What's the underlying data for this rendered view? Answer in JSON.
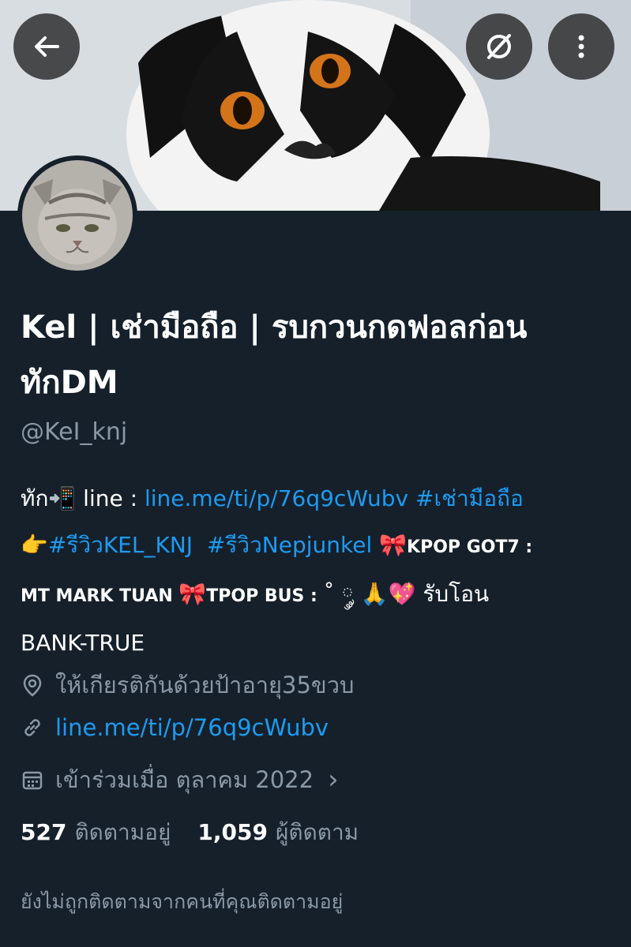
{
  "header": {
    "back_icon": "arrow-left-icon",
    "grok_icon": "slash-circle-icon",
    "more_icon": "more-vertical-icon"
  },
  "profile": {
    "name_line1": "Kel | เช่ามือถือ | รบกวนกดฟอลก่อน",
    "name_line2": "ทักDM",
    "handle": "@KeI_knj"
  },
  "bio": {
    "l1_prefix": "ทัก📲  line : ",
    "l1_link": "line.me/ti/p/76q9cWubv",
    "l1_tag": " #เช่ามือถือ",
    "l2_emoji": "👉",
    "l2_tag1": "#รีวิวKEL_KNJ",
    "l2_tag2": "#รีวิวNepjunkel",
    "l2_bow": "🎀",
    "l2_text": "KPOP GOT7 :",
    "l3_text1": "MT MARK TUAN ",
    "l3_bow": "🎀",
    "l3_text2": "TPOP BUS : ",
    "l3_symbols": "˚ ༘ ",
    "l3_emojis": "🙏💖",
    "l3_text3": " รับโอน",
    "l4_text": "BANK-TRUE"
  },
  "meta": {
    "location": "ให้เกียรติกันด้วยป้าอายุ35ขวบ",
    "website": "line.me/ti/p/76q9cWubv",
    "joined": "เข้าร่วมเมื่อ ตุลาคม 2022",
    "chevron": "›"
  },
  "stats": {
    "following_count": "527",
    "following_label": "ติดตามอยู่",
    "followers_count": "1,059",
    "followers_label": "ผู้ติดตาม"
  },
  "not_followed_text": "ยังไม่ถูกติดตามจากคนที่คุณติดตามอยู่"
}
